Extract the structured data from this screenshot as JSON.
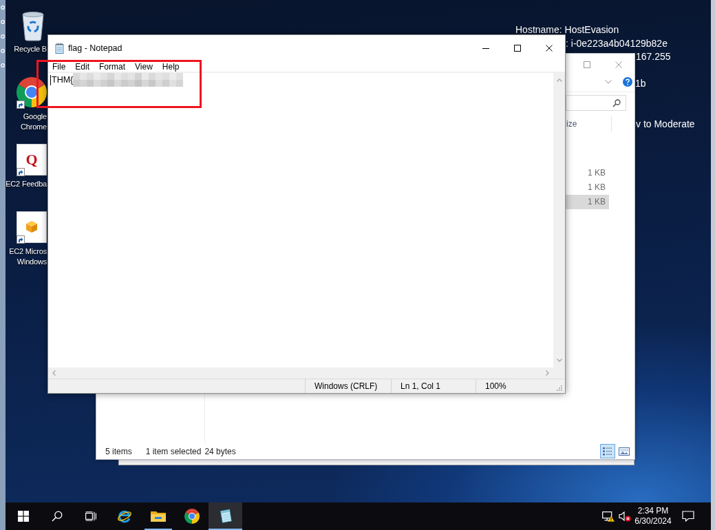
{
  "desktop": {
    "icons": [
      {
        "kind": "recycle-bin",
        "label": [
          "Recycle B"
        ],
        "shortcut": false
      },
      {
        "kind": "chrome",
        "label": [
          "Google",
          "Chrome"
        ],
        "shortcut": true
      },
      {
        "kind": "feedback",
        "glyph": "Q",
        "label": [
          "EC2 Feedba"
        ],
        "shortcut": true
      },
      {
        "kind": "package",
        "label": [
          "EC2 Micros",
          "Windows"
        ],
        "shortcut": true
      }
    ],
    "info": [
      "Hostname: HostEvasion",
      ": i-0e223a4b04129b82e",
      "167.255",
      "1b",
      "v to Moderate"
    ]
  },
  "explorer": {
    "column_header": "ize",
    "rows": [
      {
        "size": "1 KB",
        "selected": false
      },
      {
        "size": "1 KB",
        "selected": false
      },
      {
        "size": "1 KB",
        "selected": true
      }
    ],
    "status": [
      "5 items",
      "1 item selected",
      "24 bytes"
    ],
    "views": [
      {
        "kind": "details",
        "selected": true
      },
      {
        "kind": "large-icons",
        "selected": false
      }
    ]
  },
  "notepad": {
    "title": "flag - Notepad",
    "menu": [
      "File",
      "Edit",
      "Format",
      "View",
      "Help"
    ],
    "text": "THM{",
    "redacted": true,
    "status": [
      "Windows (CRLF)",
      "Ln 1, Col 1",
      "100%"
    ]
  },
  "annotation": {
    "kind": "rectangle"
  },
  "taskbar": {
    "apps": [
      {
        "kind": "internet-explorer",
        "running": false,
        "active": false
      },
      {
        "kind": "file-explorer",
        "running": true,
        "active": false
      },
      {
        "kind": "chrome",
        "running": false,
        "active": false
      },
      {
        "kind": "notepad",
        "running": true,
        "active": true
      }
    ],
    "tray": {
      "network_warning": true,
      "sound_muted": true,
      "time": "2:34 PM",
      "date": "6/30/2024"
    }
  }
}
